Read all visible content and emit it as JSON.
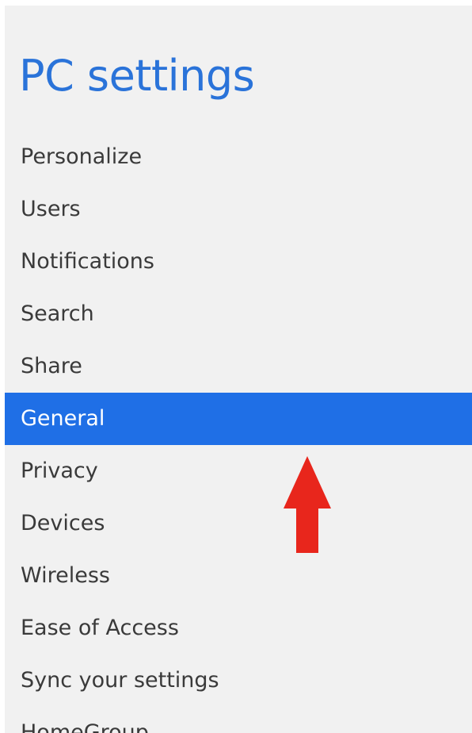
{
  "page": {
    "title": "PC settings"
  },
  "nav": {
    "items": [
      {
        "label": "Personalize"
      },
      {
        "label": "Users"
      },
      {
        "label": "Notifications"
      },
      {
        "label": "Search"
      },
      {
        "label": "Share"
      },
      {
        "label": "General"
      },
      {
        "label": "Privacy"
      },
      {
        "label": "Devices"
      },
      {
        "label": "Wireless"
      },
      {
        "label": "Ease of Access"
      },
      {
        "label": "Sync your settings"
      },
      {
        "label": "HomeGroup"
      }
    ],
    "selected_label": "General"
  },
  "colors": {
    "accent": "#1f6fe6",
    "title": "#2a73d9",
    "arrow": "#e8261c",
    "background": "#f1f1f1"
  },
  "annotation": {
    "icon": "up-arrow-icon"
  }
}
